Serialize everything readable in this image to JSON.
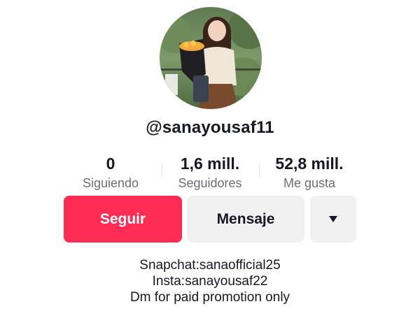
{
  "profile": {
    "username": "@sanayousaf11",
    "avatar_icon": "profile-photo"
  },
  "stats": {
    "following": {
      "value": "0",
      "label": "Siguiendo"
    },
    "followers": {
      "value": "1,6 mill.",
      "label": "Seguidores"
    },
    "likes": {
      "value": "52,8 mill.",
      "label": "Me gusta"
    }
  },
  "actions": {
    "follow_label": "Seguir",
    "message_label": "Mensaje",
    "more_icon": "caret-down-icon"
  },
  "bio": {
    "lines": [
      "Snapchat:sanaofficial25",
      "Insta:sanayousaf22",
      "Dm for paid promotion only"
    ]
  },
  "colors": {
    "accent": "#fe2c55",
    "secondary_button": "#f1f1f2",
    "muted_text": "#6b6e76",
    "text": "#161823"
  }
}
